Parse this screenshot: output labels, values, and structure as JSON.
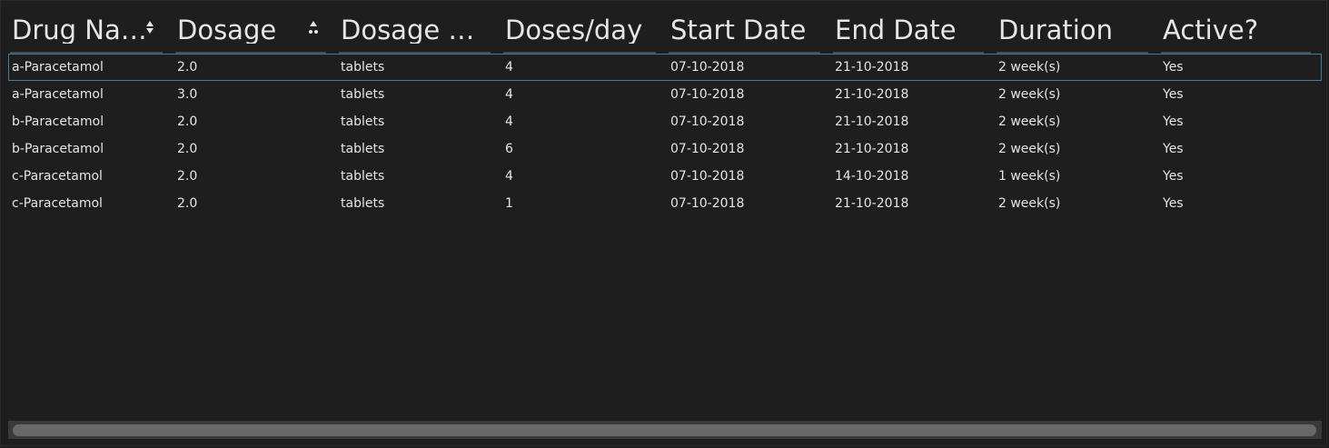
{
  "table": {
    "columns": [
      {
        "label": "Drug Na…",
        "sort": "both"
      },
      {
        "label": "Dosage",
        "sort": "both"
      },
      {
        "label": "Dosage u…",
        "sort": "none"
      },
      {
        "label": "Doses/day",
        "sort": "none"
      },
      {
        "label": "Start Date",
        "sort": "none"
      },
      {
        "label": "End Date",
        "sort": "none"
      },
      {
        "label": "Duration",
        "sort": "none"
      },
      {
        "label": "Active?",
        "sort": "none"
      }
    ],
    "rows": [
      [
        "a-Paracetamol",
        "2.0",
        "tablets",
        "4",
        "07-10-2018",
        "21-10-2018",
        "2 week(s)",
        "Yes"
      ],
      [
        "a-Paracetamol",
        "3.0",
        "tablets",
        "4",
        "07-10-2018",
        "21-10-2018",
        "2 week(s)",
        "Yes"
      ],
      [
        "b-Paracetamol",
        "2.0",
        "tablets",
        "4",
        "07-10-2018",
        "21-10-2018",
        "2 week(s)",
        "Yes"
      ],
      [
        "b-Paracetamol",
        "2.0",
        "tablets",
        "6",
        "07-10-2018",
        "21-10-2018",
        "2 week(s)",
        "Yes"
      ],
      [
        "c-Paracetamol",
        "2.0",
        "tablets",
        "4",
        "07-10-2018",
        "14-10-2018",
        "1 week(s)",
        "Yes"
      ],
      [
        "c-Paracetamol",
        "2.0",
        "tablets",
        "1",
        "07-10-2018",
        "21-10-2018",
        "2 week(s)",
        "Yes"
      ]
    ],
    "selected_row": 0
  },
  "colors": {
    "background": "#1e1e1e",
    "text": "#e6e6e6",
    "selection_border": "#3b7e95",
    "scrollbar_track": "#3a3a3a",
    "scrollbar_thumb": "#686868"
  }
}
